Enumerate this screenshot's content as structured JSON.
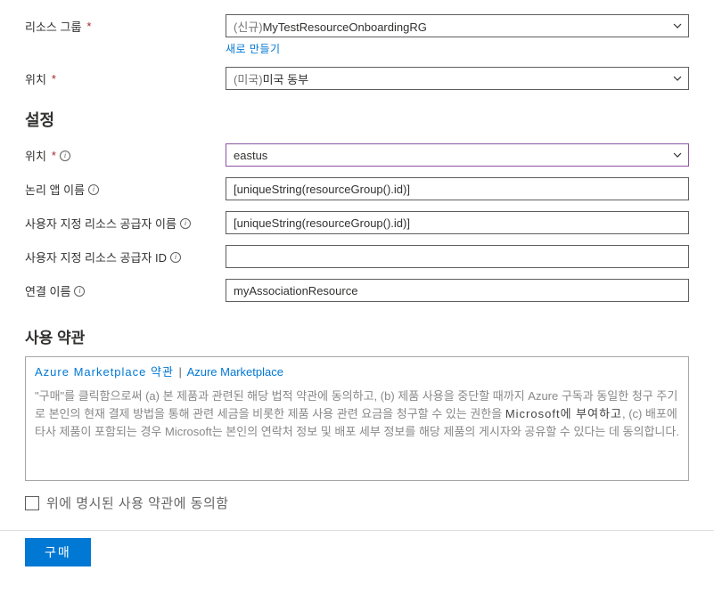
{
  "labels": {
    "resource_group": "리소스 그룹",
    "location1": "위치",
    "location2": "위치",
    "logic_app_name": "논리 앱 이름",
    "custom_rp_name": "사용자 지정 리소스 공급자 이름",
    "custom_rp_id": "사용자 지정 리소스 공급자 ID",
    "association_name": "연결 이름"
  },
  "values": {
    "resource_group_prefix": "(신규)",
    "resource_group": "MyTestResourceOnboardingRG",
    "location1_prefix": "(미국)",
    "location1": "미국 동부",
    "location2": "eastus",
    "logic_app_name": "[uniqueString(resourceGroup().id)]",
    "custom_rp_name": "[uniqueString(resourceGroup().id)]",
    "custom_rp_id": "",
    "association_name": "myAssociationResource"
  },
  "links": {
    "create_new": "새로 만들기"
  },
  "sections": {
    "settings": "설정",
    "terms": "사용 약관"
  },
  "terms": {
    "link1": "Azure Marketplace 약관",
    "sep": "|",
    "link2": "Azure Marketplace",
    "body_pre": "\"구매\"를 클릭함으로써 (a) 본 제품과 관련된 해당 법적 약관에 동의하고, (b) 제품 사용을 중단할 때까지 Azure 구독과 동일한 청구 주기로 본인의 현재 결제 방법을 통해 관련 세금을 비롯한 제품 사용 관련 요금을 청구할 수 있는 권한을 ",
    "msft_word": "Microsoft에 부여하고",
    "body_post": ", (c) 배포에 타사 제품이 포함되는 경우 Microsoft는 본인의 연락처 정보 및 배포 세부 정보를 해당 제품의 게시자와 공유할 수 있다는 데 동의합니다."
  },
  "checkbox_label": "위에 명시된 사용 약관에 동의함",
  "buy_button": "구매"
}
